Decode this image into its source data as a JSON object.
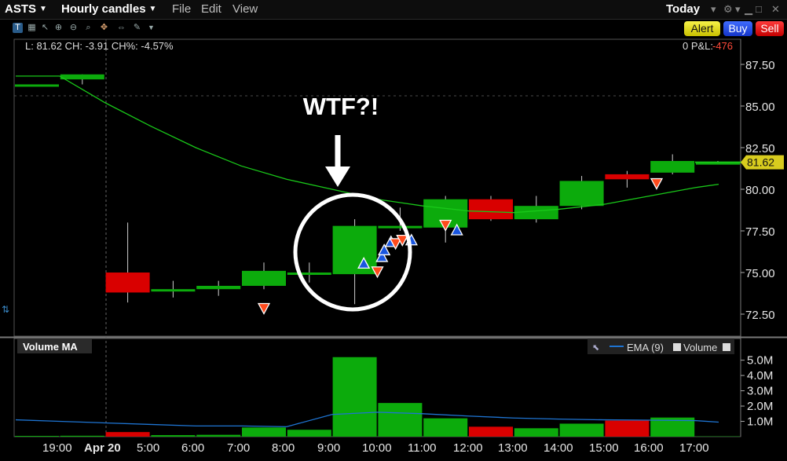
{
  "header": {
    "symbol": "ASTS",
    "chart_type": "Hourly candles",
    "menu": [
      "File",
      "Edit",
      "View"
    ],
    "period": "Today",
    "alert": "Alert",
    "buy": "Buy",
    "sell": "Sell"
  },
  "colors": {
    "up": "#0cab0c",
    "down": "#d90000",
    "ema": "#19c819",
    "volume_ema": "#1e74d2",
    "buy_marker": "#1a56e0",
    "sell_marker": "#ff4a1c"
  },
  "info": {
    "prefix": "L: 81.62 CH: -3.91 CH%: -4.57%",
    "pl_label": "0 P&L:",
    "pl_value": "-476"
  },
  "annotation": {
    "text": "WTF?!"
  },
  "price_axis": {
    "ticks": [
      "87.50",
      "85.00",
      "82.50",
      "80.00",
      "77.50",
      "75.00",
      "72.50"
    ],
    "last_price": "81.62"
  },
  "volume_panel": {
    "title": "Volume MA",
    "legend": "EMA (9)",
    "legend_volume": "Volume",
    "ticks": [
      "5.0M",
      "4.0M",
      "3.0M",
      "2.0M",
      "1.0M"
    ]
  },
  "chart_data": {
    "type": "candlestick",
    "x_labels": [
      "19:00",
      "Apr 20",
      "5:00",
      "6:00",
      "7:00",
      "8:00",
      "9:00",
      "10:00",
      "11:00",
      "12:00",
      "13:00",
      "14:00",
      "15:00",
      "16:00",
      "17:00"
    ],
    "ylim": [
      71.5,
      89.0
    ],
    "candles": [
      {
        "o": 86.3,
        "h": 86.3,
        "l": 86.3,
        "c": 86.3,
        "v": 0.05
      },
      {
        "o": 86.6,
        "h": 86.9,
        "l": 86.3,
        "c": 86.9,
        "v": 0.06
      },
      {
        "o": 75.0,
        "h": 78.0,
        "l": 73.2,
        "c": 73.8,
        "v": 0.3
      },
      {
        "o": 74.0,
        "h": 74.5,
        "l": 73.5,
        "c": 74.0,
        "v": 0.1
      },
      {
        "o": 74.0,
        "h": 74.5,
        "l": 73.6,
        "c": 74.2,
        "v": 0.12
      },
      {
        "o": 74.2,
        "h": 75.6,
        "l": 74.0,
        "c": 75.1,
        "v": 0.6
      },
      {
        "o": 75.0,
        "h": 75.6,
        "l": 74.4,
        "c": 75.0,
        "v": 0.45
      },
      {
        "o": 74.9,
        "h": 78.2,
        "l": 73.1,
        "c": 77.8,
        "v": 5.2
      },
      {
        "o": 77.8,
        "h": 78.9,
        "l": 77.5,
        "c": 77.8,
        "v": 2.2
      },
      {
        "o": 77.7,
        "h": 79.6,
        "l": 76.8,
        "c": 79.4,
        "v": 1.2
      },
      {
        "o": 79.4,
        "h": 79.6,
        "l": 78.1,
        "c": 78.2,
        "v": 0.65
      },
      {
        "o": 78.2,
        "h": 79.6,
        "l": 78.0,
        "c": 79.0,
        "v": 0.55
      },
      {
        "o": 79.0,
        "h": 80.8,
        "l": 78.8,
        "c": 80.5,
        "v": 0.85
      },
      {
        "o": 80.9,
        "h": 81.1,
        "l": 80.1,
        "c": 80.6,
        "v": 1.05
      },
      {
        "o": 81.0,
        "h": 82.1,
        "l": 80.9,
        "c": 81.7,
        "v": 1.25
      },
      {
        "o": 81.6,
        "h": 81.7,
        "l": 81.5,
        "c": 81.62,
        "v": 0.02
      }
    ],
    "ema": [
      86.8,
      86.8,
      85.2,
      83.8,
      82.5,
      81.4,
      80.6,
      80.0,
      79.4,
      79.0,
      78.7,
      78.6,
      78.8,
      79.1,
      79.6,
      80.1,
      80.3
    ],
    "volume_ema": [
      1.1,
      1.0,
      0.9,
      0.8,
      0.7,
      0.7,
      0.65,
      1.45,
      1.6,
      1.5,
      1.35,
      1.22,
      1.15,
      1.1,
      1.08,
      1.05,
      0.95
    ],
    "volume_ylim": [
      0,
      5.5
    ],
    "trades": [
      {
        "side": "sell",
        "candle": 5,
        "price": 72.9
      },
      {
        "side": "buy",
        "candle": 7.2,
        "price": 75.5
      },
      {
        "side": "sell",
        "candle": 7.5,
        "price": 75.1
      },
      {
        "side": "buy",
        "candle": 7.6,
        "price": 75.9
      },
      {
        "side": "buy",
        "candle": 7.65,
        "price": 76.3
      },
      {
        "side": "buy",
        "candle": 7.8,
        "price": 76.8
      },
      {
        "side": "sell",
        "candle": 7.9,
        "price": 76.8
      },
      {
        "side": "sell",
        "candle": 8.05,
        "price": 77.0
      },
      {
        "side": "buy",
        "candle": 8.25,
        "price": 76.9
      },
      {
        "side": "sell",
        "candle": 9.0,
        "price": 77.9
      },
      {
        "side": "buy",
        "candle": 9.25,
        "price": 77.5
      },
      {
        "side": "sell",
        "candle": 13.65,
        "price": 80.4
      }
    ]
  }
}
